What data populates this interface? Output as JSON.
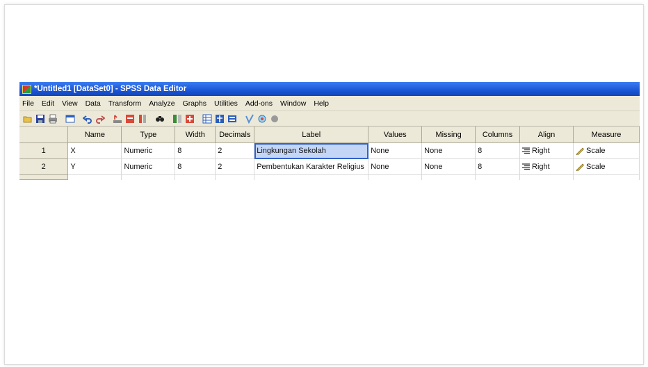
{
  "window": {
    "title": "*Untitled1 [DataSet0] - SPSS Data Editor"
  },
  "menu": [
    "File",
    "Edit",
    "View",
    "Data",
    "Transform",
    "Analyze",
    "Graphs",
    "Utilities",
    "Add-ons",
    "Window",
    "Help"
  ],
  "toolbar": [
    "open-icon",
    "save-icon",
    "print-icon",
    "dialog-recall-icon",
    "undo-icon",
    "redo-icon",
    "goto-case-icon",
    "insert-case-icon",
    "insert-variable-icon",
    "find-icon",
    "split-file-icon",
    "weight-cases-icon",
    "select-cases-icon",
    "value-labels-icon",
    "use-sets-icon",
    "spelling-icon",
    "script-icon"
  ],
  "table": {
    "columns": [
      "Name",
      "Type",
      "Width",
      "Decimals",
      "Label",
      "Values",
      "Missing",
      "Columns",
      "Align",
      "Measure"
    ],
    "rows": [
      {
        "num": "1",
        "cells": [
          "X",
          "Numeric",
          "8",
          "2",
          "Lingkungan Sekolah",
          "None",
          "None",
          "8",
          "Right",
          "Scale"
        ]
      },
      {
        "num": "2",
        "cells": [
          "Y",
          "Numeric",
          "8",
          "2",
          "Pembentukan Karakter Religius",
          "None",
          "None",
          "8",
          "Right",
          "Scale"
        ]
      }
    ]
  },
  "icons": {
    "align": "align-right-icon",
    "measure": "scale-ruler-icon"
  },
  "colors": {
    "title_bar": "#1b56d6",
    "selection": "#3261c8",
    "chrome": "#ece9d8"
  }
}
